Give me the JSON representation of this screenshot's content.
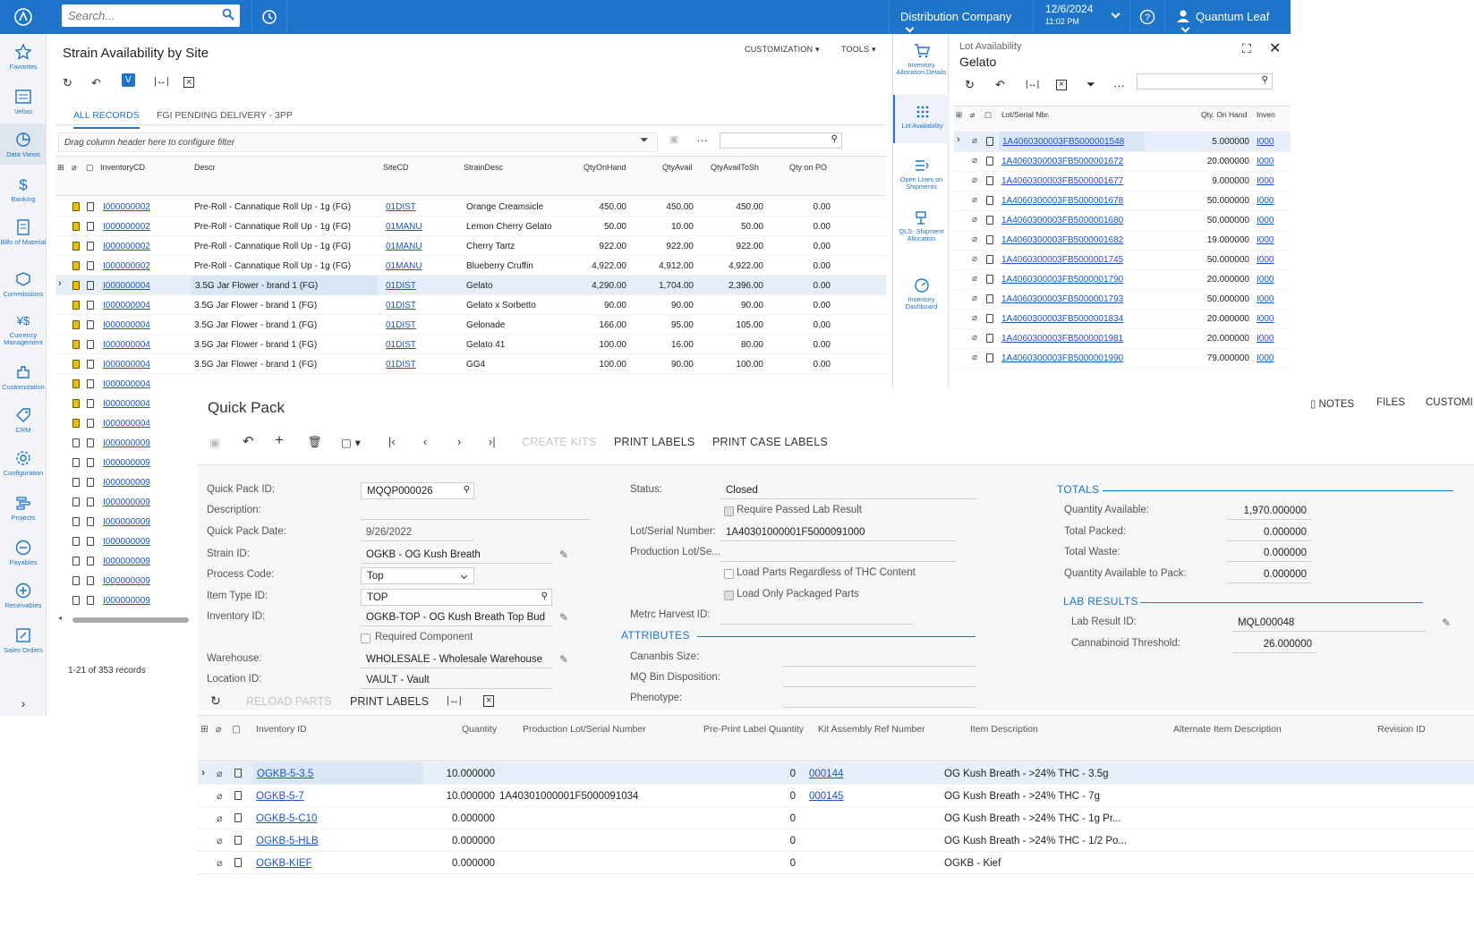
{
  "topbar": {
    "search_placeholder": "Search...",
    "company": "Distribution Company",
    "date": "12/6/2024",
    "time": "11:02 PM",
    "user": "Quantum Leaf"
  },
  "nav": [
    {
      "label": "Favorites",
      "icon": "star-icon"
    },
    {
      "label": "Velixo",
      "icon": "velixo-icon"
    },
    {
      "label": "Data Views",
      "icon": "pie-chart-icon"
    },
    {
      "label": "Banking",
      "icon": "dollar-icon"
    },
    {
      "label": "Bills of Material",
      "icon": "bom-icon"
    },
    {
      "label": "Commissions",
      "icon": "commission-icon"
    },
    {
      "label": "Currency Management",
      "icon": "currency-icon"
    },
    {
      "label": "Customization",
      "icon": "puzzle-icon"
    },
    {
      "label": "CRM",
      "icon": "tag-icon"
    },
    {
      "label": "Configuration",
      "icon": "gear-icon"
    },
    {
      "label": "Projects",
      "icon": "projects-icon"
    },
    {
      "label": "Payables",
      "icon": "minus-circle-icon"
    },
    {
      "label": "Receivables",
      "icon": "plus-circle-icon"
    },
    {
      "label": "Sales Orders",
      "icon": "edit-icon"
    }
  ],
  "strain": {
    "title": "Strain Availability by Site",
    "customization": "CUSTOMIZATION",
    "tools": "TOOLS",
    "tabs": [
      "ALL RECORDS",
      "FGI PENDING DELIVERY - 3PP"
    ],
    "filter_hint": "Drag column header here to configure filter",
    "columns": [
      "InventoryCD",
      "Descr",
      "SiteCD",
      "StrainDesc",
      "QtyOnHand",
      "QtyAvail",
      "QtyAvailToSh",
      "Qty on PO"
    ],
    "rows": [
      [
        "I000000002",
        "Pre-Roll - Cannatique Roll Up - 1g (FG)",
        "01DIST",
        "Orange Creamsicle",
        "450.00",
        "450.00",
        "450.00",
        "0.00"
      ],
      [
        "I000000002",
        "Pre-Roll - Cannatique Roll Up - 1g (FG)",
        "01MANU",
        "Lemon Cherry Gelato",
        "50.00",
        "10.00",
        "50.00",
        "0.00"
      ],
      [
        "I000000002",
        "Pre-Roll - Cannatique Roll Up - 1g (FG)",
        "01MANU",
        "Cherry Tartz",
        "922.00",
        "922.00",
        "922.00",
        "0.00"
      ],
      [
        "I000000002",
        "Pre-Roll - Cannatique Roll Up - 1g (FG)",
        "01MANU",
        "Blueberry Cruffin",
        "4,922.00",
        "4,912.00",
        "4,922.00",
        "0.00"
      ],
      [
        "I000000004",
        "3.5G Jar Flower - brand 1 (FG)",
        "01DIST",
        "Gelato",
        "4,290.00",
        "1,704.00",
        "2,396.00",
        "0.00"
      ],
      [
        "I000000004",
        "3.5G Jar Flower - brand 1 (FG)",
        "01DIST",
        "Gelato x Sorbetto",
        "90.00",
        "90.00",
        "90.00",
        "0.00"
      ],
      [
        "I000000004",
        "3.5G Jar Flower - brand 1 (FG)",
        "01DIST",
        "Gelonade",
        "166.00",
        "95.00",
        "105.00",
        "0.00"
      ],
      [
        "I000000004",
        "3.5G Jar Flower - brand 1 (FG)",
        "01DIST",
        "Gelato 41",
        "100.00",
        "16.00",
        "80.00",
        "0.00"
      ],
      [
        "I000000004",
        "3.5G Jar Flower - brand 1 (FG)",
        "01DIST",
        "GG4",
        "100.00",
        "90.00",
        "100.00",
        "0.00"
      ]
    ],
    "extra_ids": [
      "I000000004",
      "I000000004",
      "I000000004",
      "I000000009",
      "I000000009",
      "I000000009",
      "I000000009",
      "I000000009",
      "I000000009",
      "I000000009",
      "I000000009",
      "I000000009"
    ],
    "records": "1-21 of 353 records"
  },
  "sidebar2": [
    {
      "label": "Inventory Allocation Details"
    },
    {
      "label": "Lot Availability"
    },
    {
      "label": "Open Lines on Shipments"
    },
    {
      "label": "QLS- Shipment Allocation"
    },
    {
      "label": "Inventory Dashboard"
    }
  ],
  "lot": {
    "heading": "Lot Availability",
    "subheading": "Gelato",
    "columns": [
      "Lot/Serial Nbr.",
      "Qty. On Hand",
      "Inven"
    ],
    "rows": [
      [
        "1A4060300003FB5000001548",
        "5.000000",
        "I000"
      ],
      [
        "1A4060300003FB5000001672",
        "20.000000",
        "I000"
      ],
      [
        "1A4060300003FB5000001677",
        "9.000000",
        "I000"
      ],
      [
        "1A4060300003FB5000001678",
        "50.000000",
        "I000"
      ],
      [
        "1A4060300003FB5000001680",
        "50.000000",
        "I000"
      ],
      [
        "1A4060300003FB5000001682",
        "19.000000",
        "I000"
      ],
      [
        "1A4060300003FB5000001745",
        "50.000000",
        "I000"
      ],
      [
        "1A4060300003FB5000001790",
        "20.000000",
        "I000"
      ],
      [
        "1A4060300003FB5000001793",
        "50.000000",
        "I000"
      ],
      [
        "1A4060300003FB5000001834",
        "20.000000",
        "I000"
      ],
      [
        "1A4060300003FB5000001981",
        "20.000000",
        "I000"
      ],
      [
        "1A4060300003FB5000001990",
        "79.000000",
        "I000"
      ]
    ]
  },
  "qp": {
    "title": "Quick Pack",
    "notes": "NOTES",
    "files": "FILES",
    "customization": "CUSTOMI...",
    "create_kits": "CREATE KITS",
    "print_labels": "PRINT LABELS",
    "print_case_labels": "PRINT CASE LABELS",
    "fields": {
      "quick_pack_id_label": "Quick Pack ID:",
      "quick_pack_id": "MQQP000026",
      "description_label": "Description:",
      "quick_pack_date_label": "Quick Pack Date:",
      "quick_pack_date": "9/26/2022",
      "strain_id_label": "Strain ID:",
      "strain_id": "OGKB - OG Kush Breath",
      "process_code_label": "Process Code:",
      "process_code": "Top",
      "item_type_id_label": "Item Type ID:",
      "item_type_id": "TOP",
      "inventory_id_label": "Inventory ID:",
      "inventory_id": "OGKB-TOP - OG Kush Breath Top Bud",
      "required_component": "Required Component",
      "warehouse_label": "Warehouse:",
      "warehouse": "WHOLESALE - Wholesale Warehouse",
      "location_id_label": "Location ID:",
      "location_id": "VAULT - Vault",
      "status_label": "Status:",
      "status": "Closed",
      "require_passed_lab": "Require Passed Lab Result",
      "lot_serial_label": "Lot/Serial Number:",
      "lot_serial": "1A40301000001F5000091000",
      "production_lot_label": "Production Lot/Se...",
      "load_parts": "Load Parts Regardless of THC Content",
      "load_only_packaged": "Load Only Packaged Parts",
      "metrc_label": "Metrc Harvest ID:",
      "attributes": "ATTRIBUTES",
      "cannabis_size_label": "Cananbis Size:",
      "mq_bin_label": "MQ Bin Disposition:",
      "phenotype_label": "Phenotype:",
      "totals": "TOTALS",
      "qty_available_label": "Quantity Available:",
      "qty_available": "1,970.000000",
      "total_packed_label": "Total Packed:",
      "total_packed": "0.000000",
      "total_waste_label": "Total Waste:",
      "total_waste": "0.000000",
      "qty_avail_pack_label": "Quantity Available to Pack:",
      "qty_avail_pack": "0.000000",
      "lab_results": "LAB RESULTS",
      "lab_result_id_label": "Lab Result ID:",
      "lab_result_id": "MQL000048",
      "cannabinoid_label": "Cannabinoid Threshold:",
      "cannabinoid": "26.000000"
    },
    "grid_toolbar": {
      "reload": "RELOAD PARTS",
      "print": "PRINT LABELS"
    },
    "columns": [
      "Inventory ID",
      "Quantity",
      "Production Lot/Serial Number",
      "Pre-Print Label Quantity",
      "Kit Assembly Ref Number",
      "Item Description",
      "Alternate Item Description",
      "Revision ID"
    ],
    "rows": [
      [
        "OGKB-5-3.5",
        "10.000000",
        "",
        "0",
        "000144",
        "OG Kush Breath - >24% THC - 3.5g"
      ],
      [
        "OGKB-5-7",
        "10.000000",
        "1A40301000001F5000091034",
        "0",
        "000145",
        "OG Kush Breath - >24% THC - 7g"
      ],
      [
        "OGKB-5-C10",
        "0.000000",
        "",
        "0",
        "",
        "OG Kush Breath - >24% THC - 1g Pr..."
      ],
      [
        "OGKB-5-HLB",
        "0.000000",
        "",
        "0",
        "",
        "OG Kush Breath - >24% THC - 1/2 Po..."
      ],
      [
        "OGKB-KIEF",
        "0.000000",
        "",
        "0",
        "",
        "OGKB - Kief"
      ]
    ]
  },
  "colors": {
    "brand": "#1e74c8",
    "link": "#1a55c8",
    "selected_row": "#e5eef9"
  }
}
